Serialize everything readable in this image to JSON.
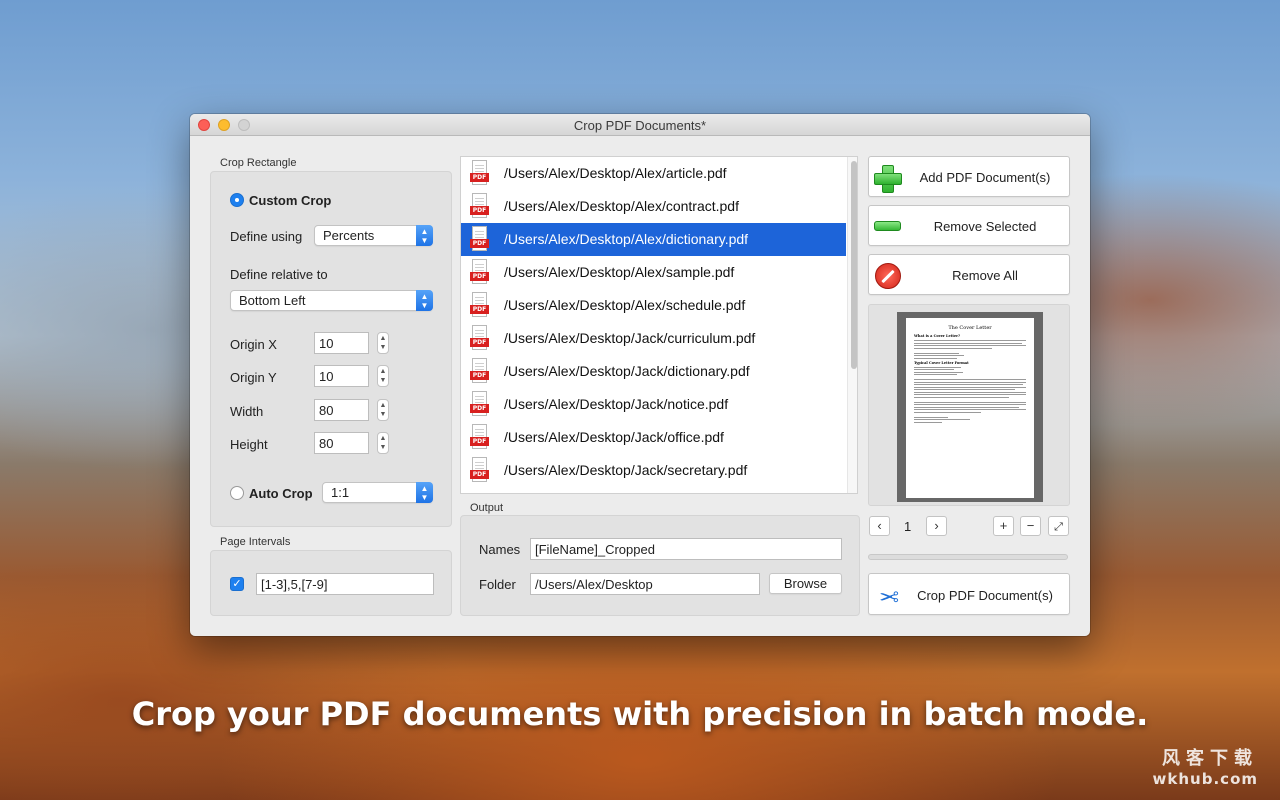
{
  "window": {
    "title": "Crop PDF Documents*"
  },
  "crop_rectangle": {
    "section_label": "Crop Rectangle",
    "custom_crop_label": "Custom Crop",
    "define_using_label": "Define using",
    "define_using_value": "Percents",
    "define_relative_label": "Define relative to",
    "define_relative_value": "Bottom Left",
    "origin_x_label": "Origin X",
    "origin_x_value": "10",
    "origin_y_label": "Origin Y",
    "origin_y_value": "10",
    "width_label": "Width",
    "width_value": "80",
    "height_label": "Height",
    "height_value": "80",
    "auto_crop_label": "Auto Crop",
    "auto_crop_value": "1:1"
  },
  "page_intervals": {
    "section_label": "Page Intervals",
    "checked": true,
    "value": "[1-3],5,[7-9]"
  },
  "files": [
    {
      "path": "/Users/Alex/Desktop/Alex/article.pdf",
      "selected": false
    },
    {
      "path": "/Users/Alex/Desktop/Alex/contract.pdf",
      "selected": false
    },
    {
      "path": "/Users/Alex/Desktop/Alex/dictionary.pdf",
      "selected": true
    },
    {
      "path": "/Users/Alex/Desktop/Alex/sample.pdf",
      "selected": false
    },
    {
      "path": "/Users/Alex/Desktop/Alex/schedule.pdf",
      "selected": false
    },
    {
      "path": "/Users/Alex/Desktop/Jack/curriculum.pdf",
      "selected": false
    },
    {
      "path": "/Users/Alex/Desktop/Jack/dictionary.pdf",
      "selected": false
    },
    {
      "path": "/Users/Alex/Desktop/Jack/notice.pdf",
      "selected": false
    },
    {
      "path": "/Users/Alex/Desktop/Jack/office.pdf",
      "selected": false
    },
    {
      "path": "/Users/Alex/Desktop/Jack/secretary.pdf",
      "selected": false
    }
  ],
  "file_icon": {
    "icon": "pdf-file-icon",
    "tag": "PDF"
  },
  "output": {
    "section_label": "Output",
    "names_label": "Names",
    "names_value": "[FileName]_Cropped",
    "folder_label": "Folder",
    "folder_value": "/Users/Alex/Desktop",
    "browse_label": "Browse"
  },
  "actions": {
    "add_label": "Add PDF Document(s)",
    "remove_selected_label": "Remove Selected",
    "remove_all_label": "Remove All",
    "crop_label": "Crop PDF Document(s)"
  },
  "preview": {
    "page_number": "1",
    "prev_icon": "chevron-left-icon",
    "next_icon": "chevron-right-icon",
    "zoom_in_icon": "zoom-in-icon",
    "zoom_out_icon": "zoom-out-icon",
    "fullscreen_icon": "fullscreen-icon",
    "doc_title": "The Cover Letter",
    "doc_heading_1": "What is a Cover Letter?",
    "doc_heading_2": "Typical Cover Letter Format"
  },
  "caption": "Crop your PDF documents with precision in batch mode.",
  "watermark": {
    "cn": "风客下载",
    "en": "wkhub.com"
  },
  "colors": {
    "accent": "#1d64d9",
    "selection": "#1d64d9",
    "pdf_red": "#d8201f"
  }
}
